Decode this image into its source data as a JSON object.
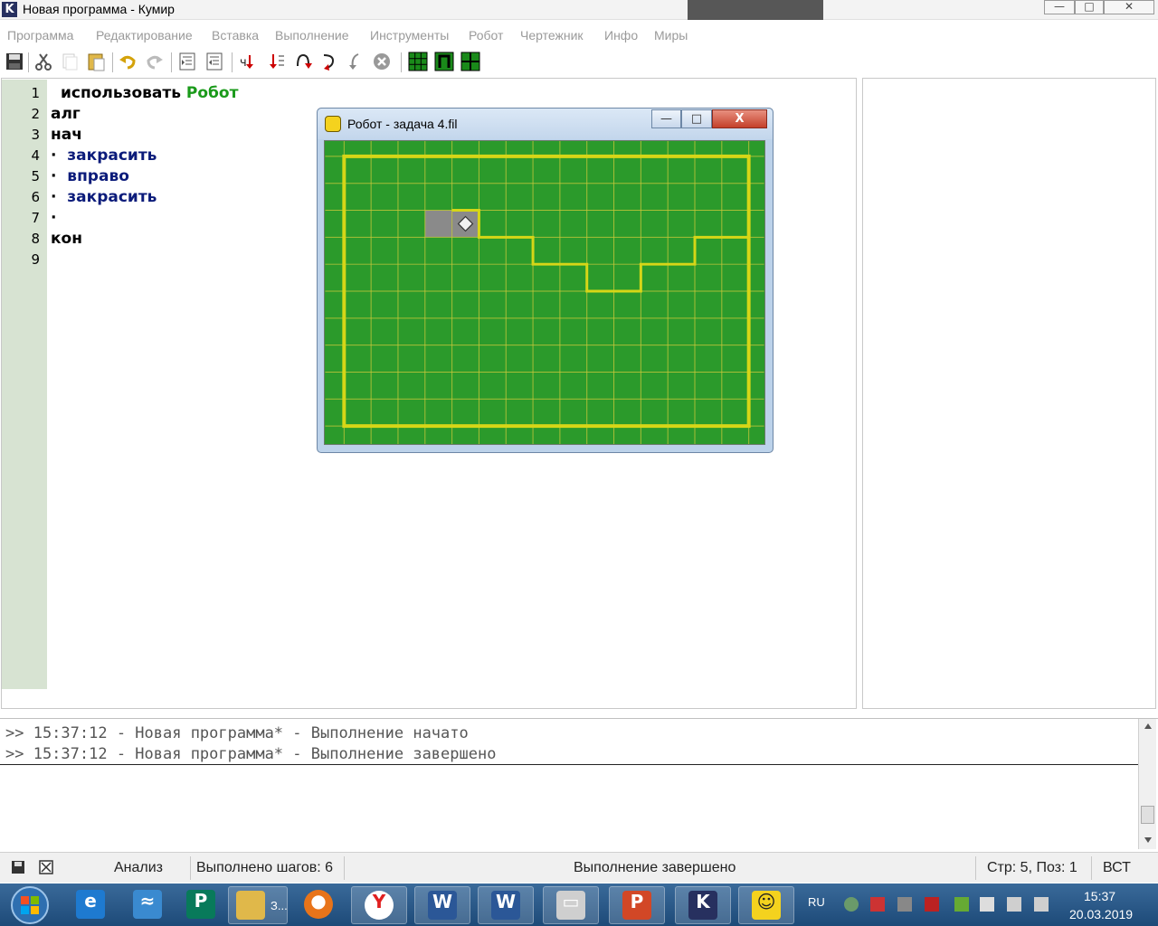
{
  "window": {
    "logo_letter": "K",
    "title": "Новая программа - Кумир",
    "minimize_glyph": "—",
    "maximize_glyph": "□",
    "close_glyph": "✕"
  },
  "menu": [
    "Программа",
    "Редактирование",
    "Вставка",
    "Выполнение",
    "Инструменты",
    "Робот",
    "Чертежник",
    "Инфо",
    "Миры"
  ],
  "toolbar_icons": [
    "save-icon",
    "cut-icon",
    "copy-icon",
    "paste-icon",
    "undo-icon",
    "redo-icon",
    "indent-icon",
    "unindent-icon",
    "run-icon",
    "step-into-icon",
    "step-over-icon",
    "step-out-icon",
    "step-back-icon",
    "stop-icon",
    "robot-grid-icon",
    "draw-icon",
    "robot-window-icon"
  ],
  "editor": {
    "line_numbers": [
      "1",
      "2",
      "3",
      "4",
      "5",
      "6",
      "7",
      "8",
      "9"
    ],
    "lines": [
      {
        "parts": [
          {
            "text": "использовать ",
            "style": "plain"
          },
          {
            "text": "Робот",
            "style": "green"
          }
        ],
        "indent": 1
      },
      {
        "parts": [
          {
            "text": "алг",
            "style": "plain"
          }
        ],
        "indent": 0
      },
      {
        "parts": [
          {
            "text": "нач",
            "style": "plain"
          }
        ],
        "indent": 0
      },
      {
        "parts": [
          {
            "text": "·",
            "style": "plain"
          },
          {
            "text": "  закрасить",
            "style": "blue"
          }
        ],
        "indent": 0
      },
      {
        "parts": [
          {
            "text": "·",
            "style": "plain"
          },
          {
            "text": "  вправо",
            "style": "blue"
          }
        ],
        "indent": 0
      },
      {
        "parts": [
          {
            "text": "·",
            "style": "plain"
          },
          {
            "text": "  закрасить",
            "style": "blue"
          }
        ],
        "indent": 0
      },
      {
        "parts": [
          {
            "text": "·",
            "style": "plain"
          }
        ],
        "indent": 0
      },
      {
        "parts": [
          {
            "text": "кон",
            "style": "plain"
          }
        ],
        "indent": 0
      },
      {
        "parts": [],
        "indent": 0
      }
    ]
  },
  "robot_window": {
    "title": "Робот - задача 4.fil",
    "minimize_glyph": "—",
    "maximize_glyph": "□",
    "close_glyph": "X",
    "field": {
      "cols": 16,
      "rows": 11,
      "field_color": "#2b9a2b",
      "grid_color": "#c7c73a",
      "wall_color": "#d6d617",
      "painted_color": "#8a8a8a",
      "painted_cells": [
        [
          3,
          2
        ],
        [
          4,
          2
        ]
      ],
      "robot_cell": [
        4,
        2
      ]
    }
  },
  "console": {
    "lines": [
      ">> 15:37:12 - Новая программа* - Выполнение начато",
      ">> 15:37:12 - Новая программа* - Выполнение завершено"
    ]
  },
  "statusbar": {
    "analysis": "Анализ",
    "steps": "Выполнено шагов: 6",
    "state": "Выполнение завершено",
    "position": "Стр: 5, Поз: 1",
    "mode": "ВСТ"
  },
  "taskbar": {
    "start_icon": "windows-start-icon",
    "items": [
      {
        "icon": "internet-explorer-icon",
        "label": ""
      },
      {
        "icon": "network-app-icon",
        "label": ""
      },
      {
        "icon": "publisher-icon",
        "label": ""
      },
      {
        "icon": "folder-icon",
        "label": "З..."
      },
      {
        "icon": "firefox-icon",
        "label": ""
      },
      {
        "icon": "yandex-browser-icon",
        "label": ""
      },
      {
        "icon": "word-icon",
        "label": ""
      },
      {
        "icon": "word-icon",
        "label": ""
      },
      {
        "icon": "printer-icon",
        "label": ""
      },
      {
        "icon": "powerpoint-icon",
        "label": ""
      },
      {
        "icon": "kumir-icon",
        "label": ""
      },
      {
        "icon": "robot-smiley-icon",
        "label": ""
      }
    ],
    "language": "RU",
    "time": "15:37",
    "date": "20.03.2019"
  },
  "colors": {
    "keyword_green": "#1a9a1a",
    "keyword_blue": "#0b1b7a",
    "gutter": "#d7e3d2",
    "taskbar": "#1d4a78"
  }
}
